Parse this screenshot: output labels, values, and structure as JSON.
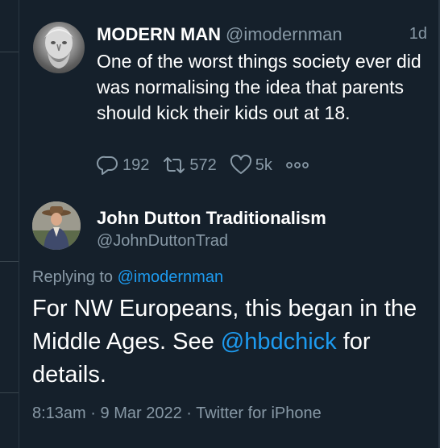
{
  "parent_tweet": {
    "author_name": "MODERN MAN",
    "author_handle": "@imodernman",
    "time": "1d",
    "text": "One of the worst things society ever did was normalising the idea that parents should kick their kids out at 18.",
    "reply_count": "192",
    "retweet_count": "572",
    "like_count": "5k"
  },
  "reply_tweet": {
    "author_name": "John Dutton Traditionalism",
    "author_handle": "@JohnDuttonTrad",
    "replying_label": "Replying to",
    "replying_to": "@imodernman",
    "text_part1": "For NW Europeans, this began in the Middle Ages. See",
    "mention": "@hbdchick",
    "text_part2": "for details.",
    "time": "8:13am",
    "date": "9 Mar 2022",
    "source": "Twitter for iPhone"
  },
  "colors": {
    "background": "#15202b",
    "text": "#ffffff",
    "secondary": "#8899a6",
    "link": "#1d9bf0"
  },
  "icons": [
    "reply-icon",
    "retweet-icon",
    "like-icon",
    "more-icon"
  ]
}
